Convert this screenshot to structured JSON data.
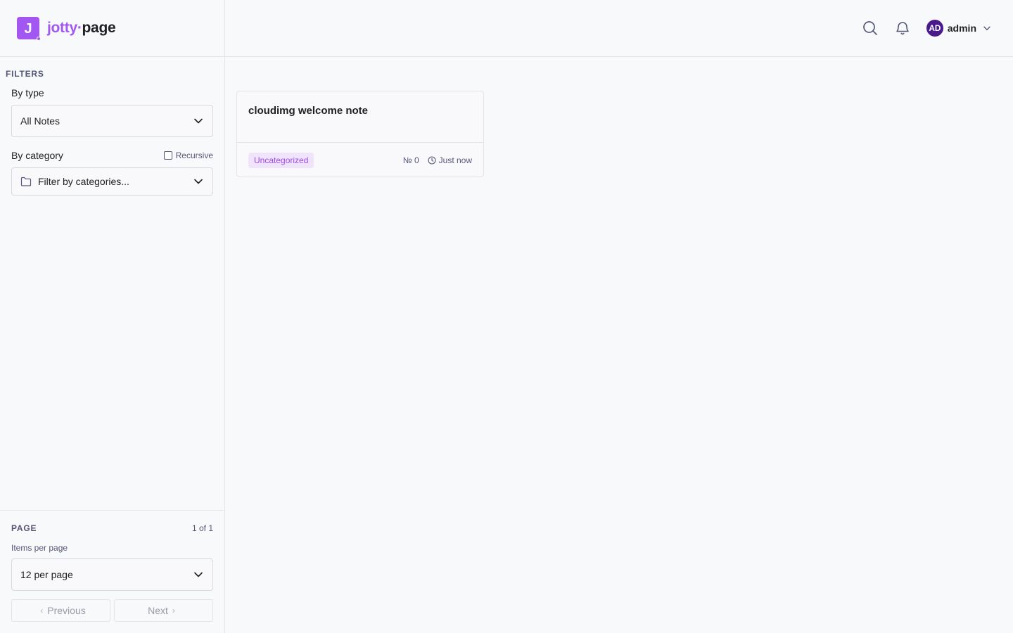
{
  "brand": {
    "mark": "J",
    "name_part1": "jotty",
    "name_sep": "·",
    "name_part2": "page"
  },
  "header": {
    "user": {
      "initials": "AD",
      "name": "admin"
    }
  },
  "filters": {
    "title": "FILTERS",
    "by_type": {
      "label": "By type",
      "value": "All Notes"
    },
    "by_category": {
      "label": "By category",
      "recursive_label": "Recursive",
      "recursive_checked": false,
      "placeholder": "Filter by categories..."
    }
  },
  "pagination": {
    "title": "PAGE",
    "count": "1 of 1",
    "items_per_page_label": "Items per page",
    "items_per_page_value": "12 per page",
    "previous_label": "Previous",
    "next_label": "Next"
  },
  "notes": [
    {
      "title": "cloudimg welcome note",
      "category": "Uncategorized",
      "number": "№ 0",
      "time": "Just now"
    }
  ],
  "colors": {
    "accent": "#a157f0",
    "avatar": "#4a1a8c",
    "tag_bg": "#f0e4fc",
    "tag_text": "#9a4ae8"
  }
}
